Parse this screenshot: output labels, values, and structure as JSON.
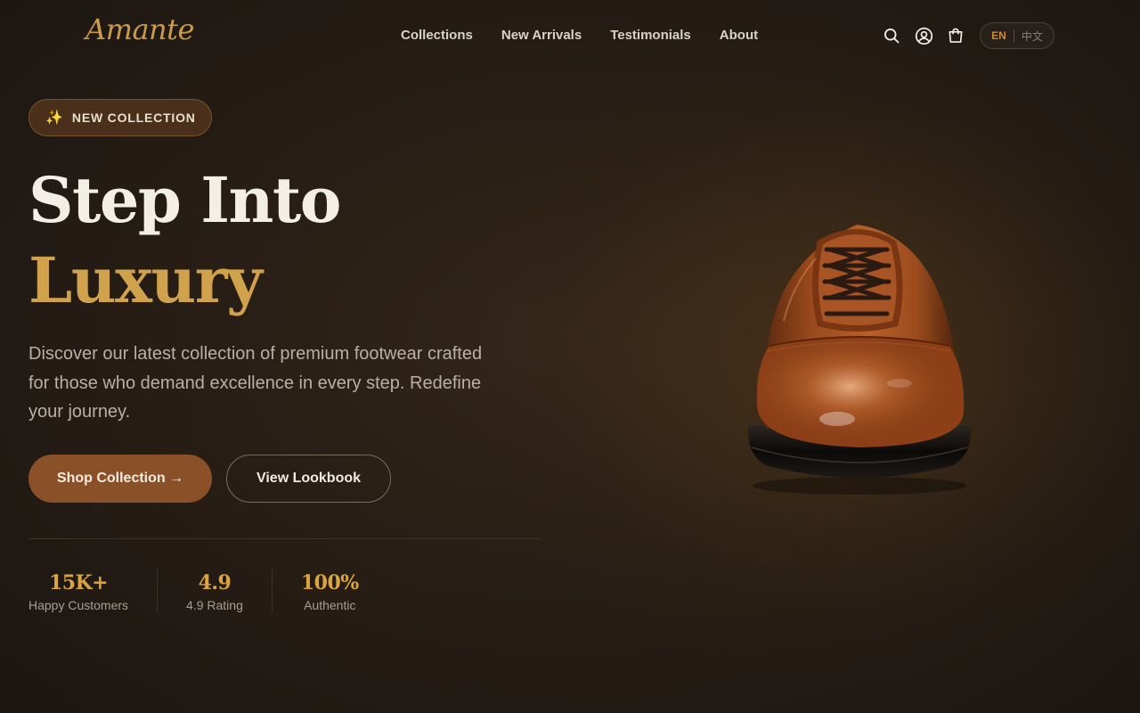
{
  "brand": {
    "logo": "Amante"
  },
  "nav": {
    "items": [
      "Collections",
      "New Arrivals",
      "Testimonials",
      "About"
    ]
  },
  "header_icons": [
    "search-icon",
    "user-icon",
    "cart-icon"
  ],
  "language": {
    "active": "EN",
    "other": "中文"
  },
  "hero": {
    "badge": "NEW COLLECTION",
    "badge_icon": "sparkles-icon",
    "title_line1": "Step Into",
    "title_line2": "Luxury",
    "description": "Discover our latest collection of premium footwear crafted for those who demand excellence in every step. Redefine your journey.",
    "primary_button": "Shop Collection →",
    "secondary_button": "View Lookbook"
  },
  "stats": [
    {
      "value": "15K+",
      "label": "Happy Customers"
    },
    {
      "value": "4.9",
      "label": "4.9 Rating"
    },
    {
      "value": "100%",
      "label": "Authentic"
    }
  ],
  "colors": {
    "accent_gold": "#d0a24c",
    "button_brown": "#8a5128",
    "background": "#261d15"
  }
}
